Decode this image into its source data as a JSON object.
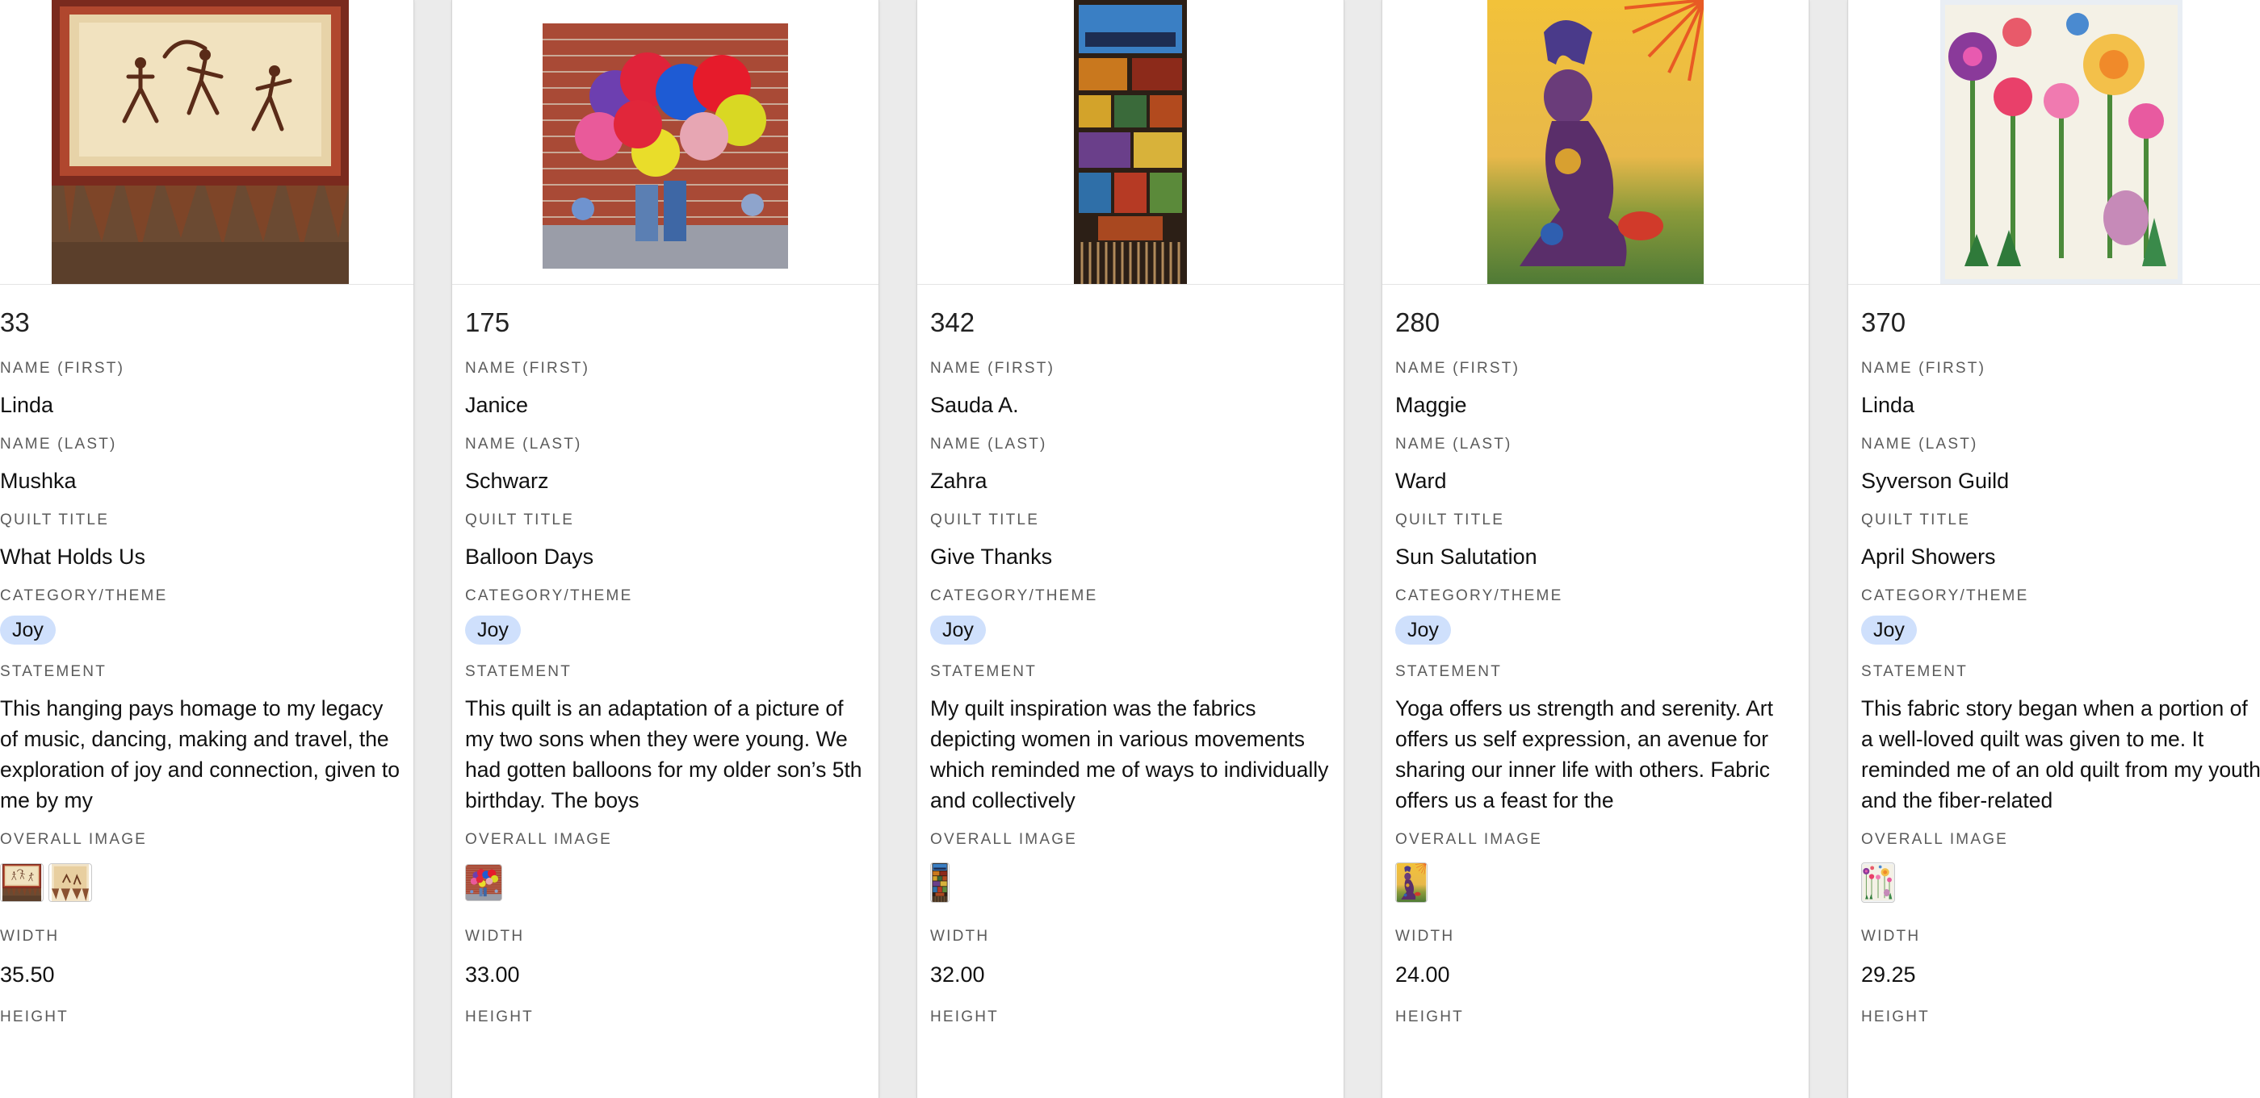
{
  "labels": {
    "name_first": "NAME (FIRST)",
    "name_last": "NAME (LAST)",
    "quilt_title": "QUILT TITLE",
    "category": "CATEGORY/THEME",
    "statement": "STATEMENT",
    "overall_image": "OVERALL IMAGE",
    "width": "WIDTH",
    "height": "HEIGHT"
  },
  "cards": [
    {
      "id": "33",
      "first": "Linda",
      "last": "Mushka",
      "title": "What Holds Us",
      "category": "Joy",
      "statement": "This hanging pays homage to my legacy of music, dancing, making and travel, the exploration of joy and connection, given to me by my",
      "width": "35.50",
      "image": "quilt-dancers",
      "thumbs": [
        "quilt-dancers",
        "quilt-dancers-detail"
      ]
    },
    {
      "id": "175",
      "first": "Janice",
      "last": "Schwarz",
      "title": "Balloon Days",
      "category": "Joy",
      "statement": "This quilt is an adaptation of a picture of my two sons when they were young. We had gotten balloons for my older son’s 5th birthday. The boys",
      "width": "33.00",
      "image": "quilt-balloons",
      "thumbs": [
        "quilt-balloons"
      ]
    },
    {
      "id": "342",
      "first": "Sauda A.",
      "last": "Zahra",
      "title": "Give Thanks",
      "category": "Joy",
      "statement": "My quilt inspiration was the fabrics depicting women in various movements which reminded me of ways to individually and collectively",
      "width": "32.00",
      "image": "quilt-panels",
      "thumbs": [
        "quilt-panels"
      ]
    },
    {
      "id": "280",
      "first": "Maggie",
      "last": "Ward",
      "title": "Sun Salutation",
      "category": "Joy",
      "statement": "Yoga offers us strength and serenity. Art offers us self expression, an avenue for sharing our inner life with others. Fabric offers us a feast for the",
      "width": "24.00",
      "image": "quilt-yoga",
      "thumbs": [
        "quilt-yoga"
      ]
    },
    {
      "id": "370",
      "first": "Linda",
      "last": "Syverson Guild",
      "title": "April Showers",
      "category": "Joy",
      "statement": "This fabric story began when a portion of a well-loved quilt was given to me. It reminded me of an old quilt from my youth and the fiber-related",
      "width": "29.25",
      "image": "quilt-flowers",
      "thumbs": [
        "quilt-flowers"
      ]
    }
  ]
}
